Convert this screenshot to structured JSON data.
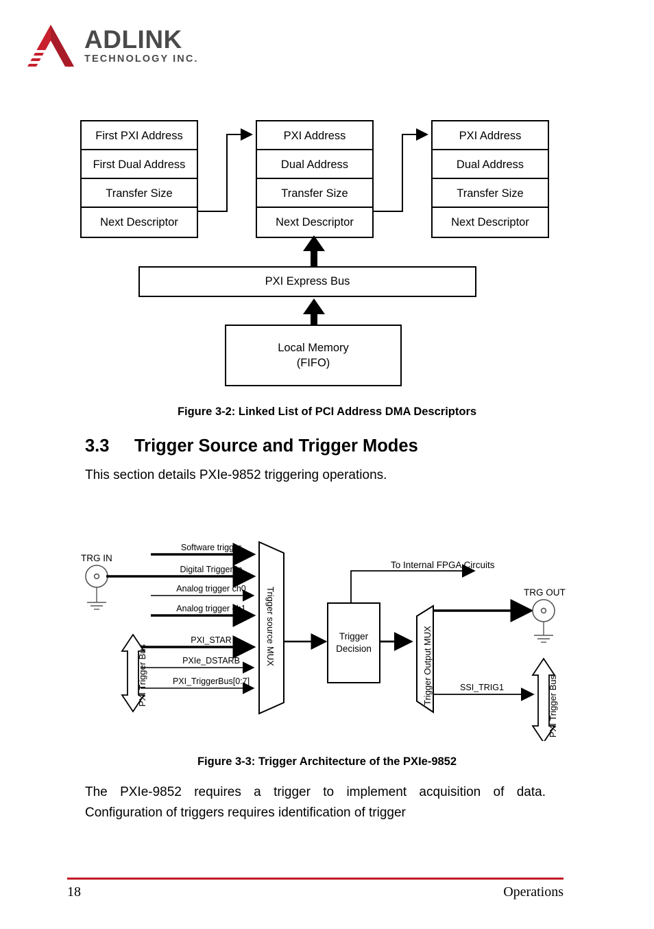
{
  "header": {
    "logo_word": "ADLINK",
    "logo_sub": "TECHNOLOGY INC.",
    "logo_reg": "®",
    "brand_color": "#c01722"
  },
  "figure_3_2": {
    "caption": "Figure 3-2: Linked List of PCI Address DMA Descriptors",
    "descriptors": [
      {
        "rows": [
          "First PXI Address",
          "First Dual Address",
          "Transfer Size",
          "Next Descriptor"
        ]
      },
      {
        "rows": [
          "PXI Address",
          "Dual Address",
          "Transfer Size",
          "Next Descriptor"
        ]
      },
      {
        "rows": [
          "PXI Address",
          "Dual Address",
          "Transfer Size",
          "Next Descriptor"
        ]
      }
    ],
    "bus_label": "PXI Express Bus",
    "memory_label": "Local Memory\n(FIFO)",
    "memory_line1": "Local Memory",
    "memory_line2": "(FIFO)"
  },
  "section": {
    "number": "3.3",
    "title": "Trigger Source and Trigger Modes",
    "intro": "This section details PXIe-9852 triggering operations."
  },
  "figure_3_3": {
    "caption": "Figure 3-3: Trigger Architecture of the PXIe-9852",
    "trg_in_label": "TRG IN",
    "trg_out_label": "TRG OUT",
    "source_mux_label": "Trigger source MUX",
    "output_mux_label": "Trigger Output MUX",
    "decision_line1": "Trigger",
    "decision_line2": "Decision",
    "fpga_label": "To Internal FPGA Circuits",
    "ssi_label": "SSI_TRIG1",
    "bus_left_label": "PXI Trigger Bus",
    "bus_right_label": "PXI Trigger Bus",
    "signals": [
      "Software trigger",
      "Digital Trigger In",
      "Analog trigger ch0",
      "Analog trigger ch1",
      "PXI_STAR",
      "PXIe_DSTARB",
      "PXI_TriggerBus[0:7]"
    ]
  },
  "body": {
    "paragraph": "The PXIe-9852 requires a trigger to implement acquisition of data. Configuration of triggers requires identification of trigger"
  },
  "footer": {
    "page_number": "18",
    "section_name": "Operations",
    "rule_color": "#c01722"
  }
}
